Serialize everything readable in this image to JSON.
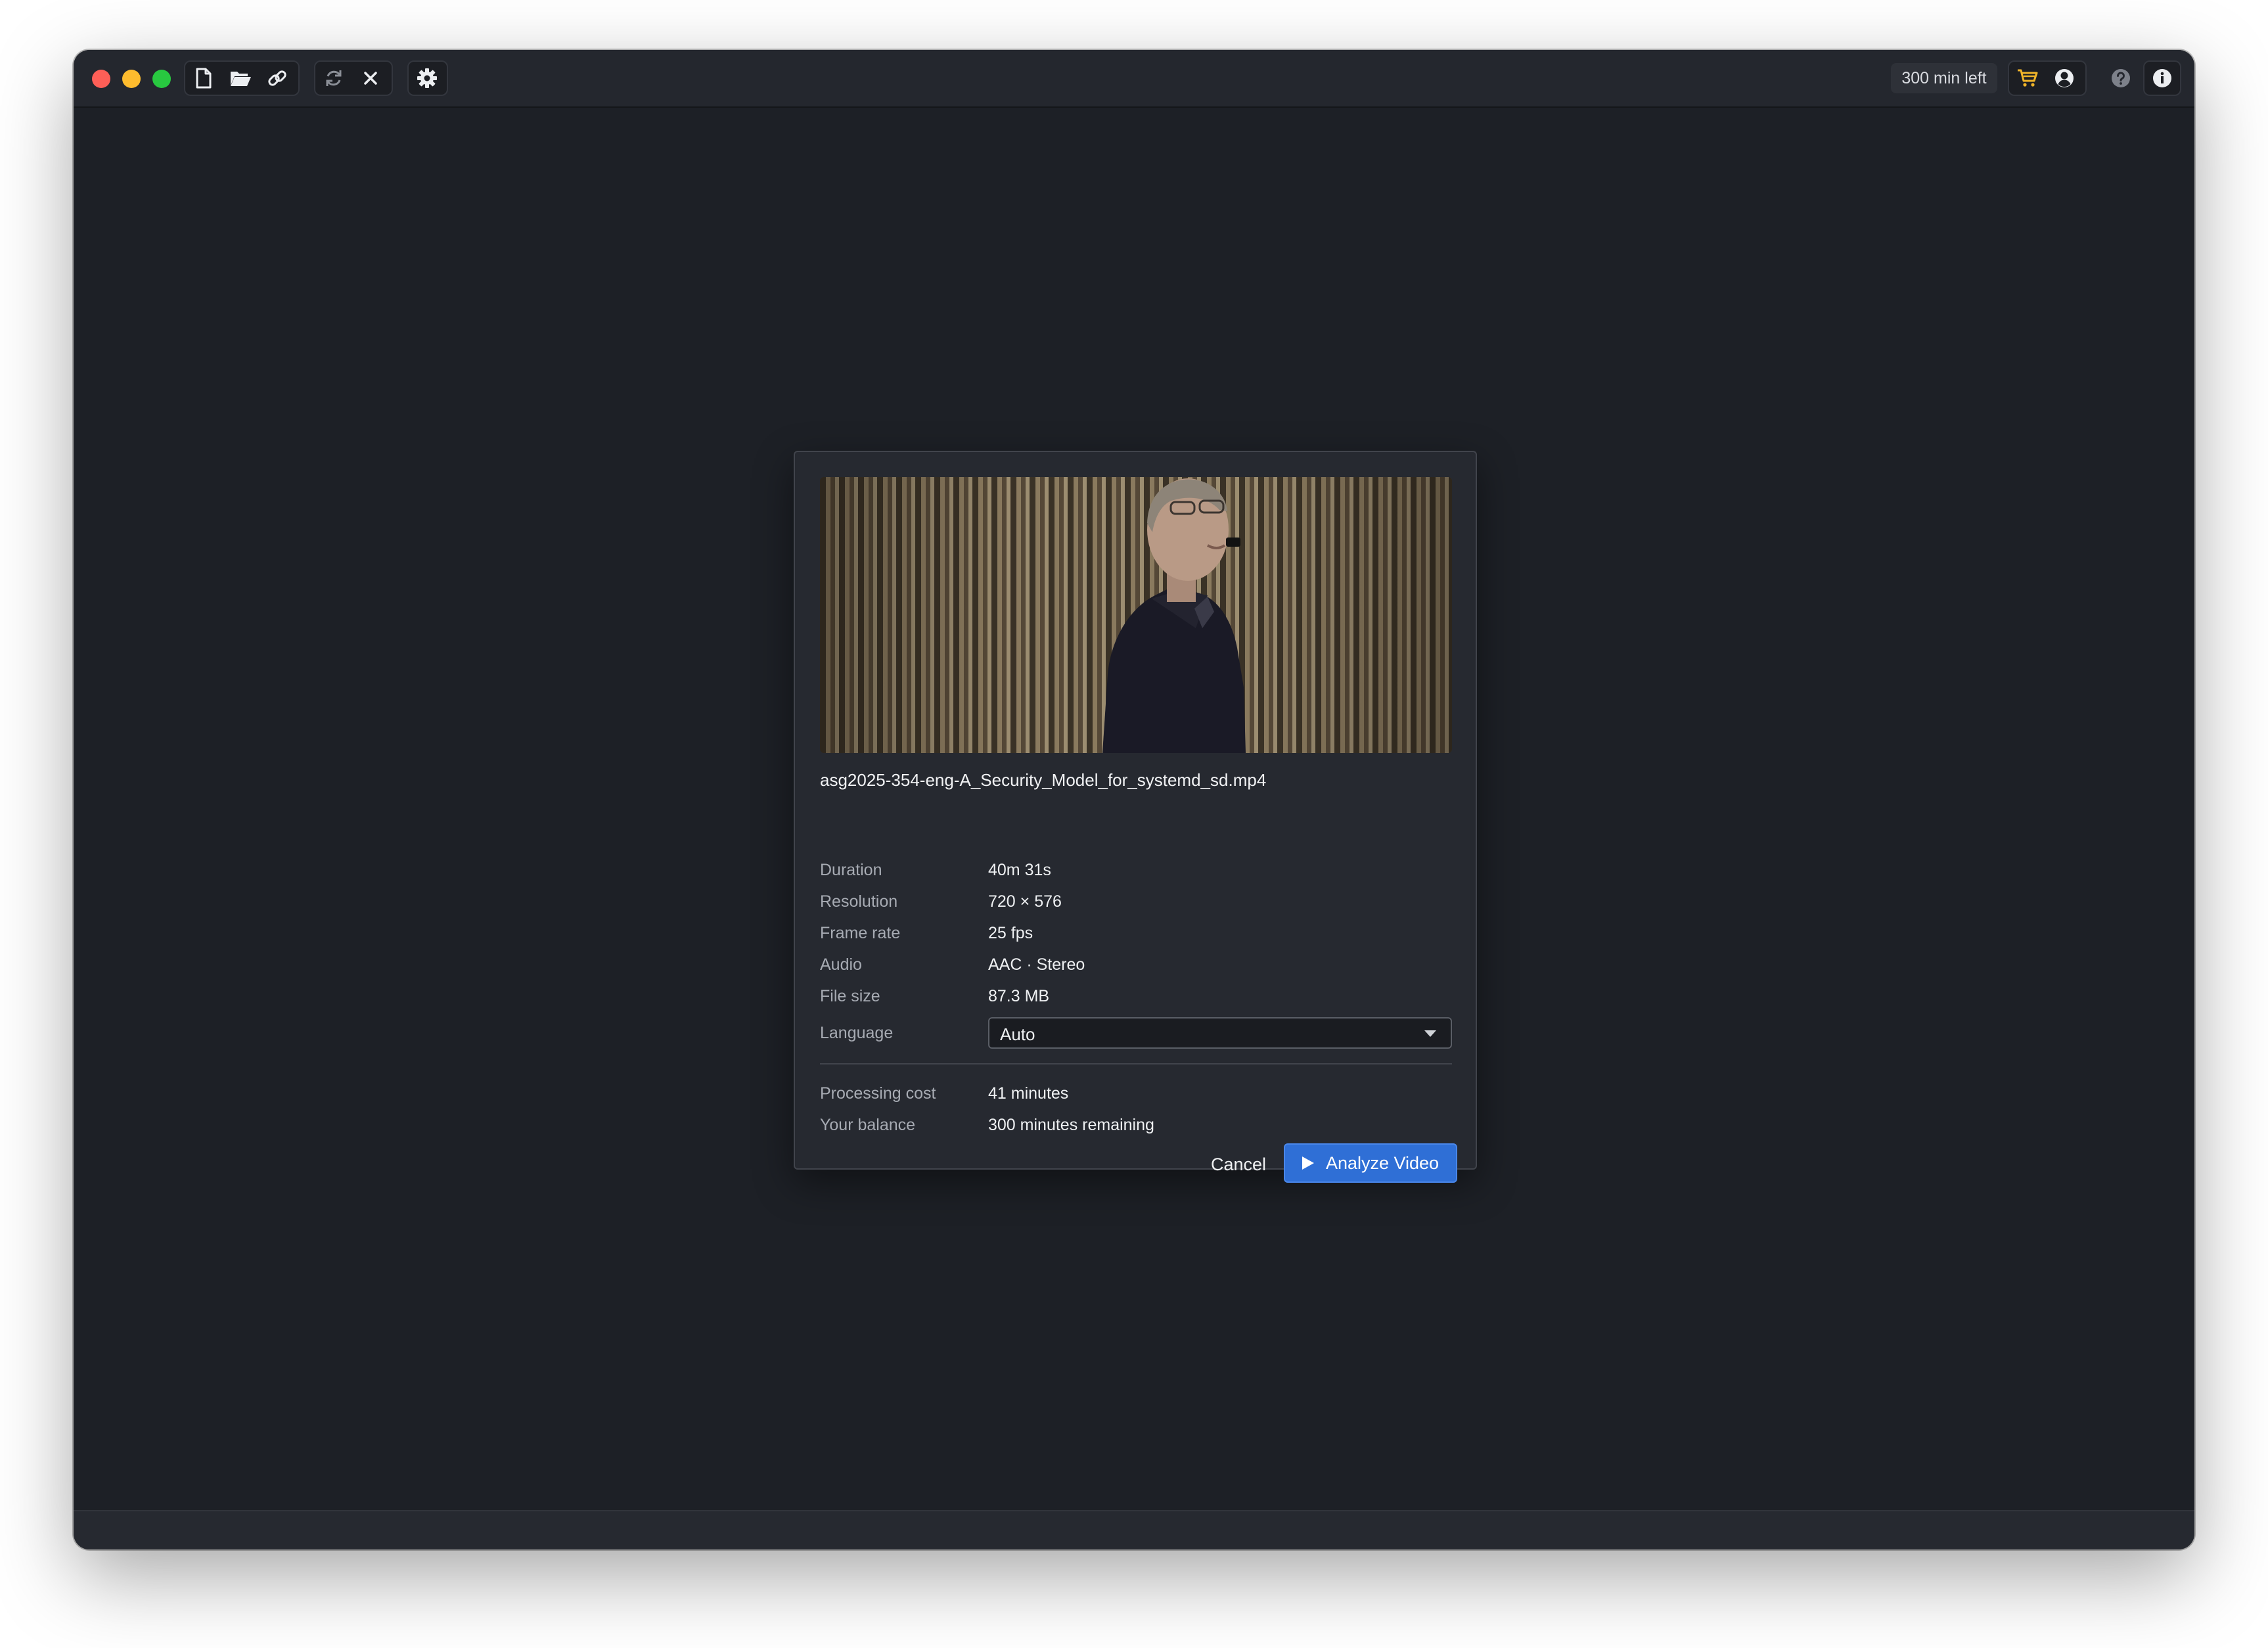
{
  "toolbar": {
    "credits_label": "300 min left"
  },
  "dialog": {
    "filename": "asg2025-354-eng-A_Security_Model_for_systemd_sd.mp4",
    "info": [
      {
        "label": "Duration",
        "value": "40m 31s"
      },
      {
        "label": "Resolution",
        "value": "720 × 576"
      },
      {
        "label": "Frame rate",
        "value": "25 fps"
      },
      {
        "label": "Audio",
        "value": "AAC · Stereo"
      },
      {
        "label": "File size",
        "value": "87.3 MB"
      }
    ],
    "language": {
      "label": "Language",
      "value": "Auto"
    },
    "cost": [
      {
        "label": "Processing cost",
        "value": "41 minutes"
      },
      {
        "label": "Your balance",
        "value": "300 minutes remaining"
      }
    ],
    "cancel_label": "Cancel",
    "analyze_label": "Analyze Video"
  },
  "colors": {
    "accent": "#2f6fd6",
    "cart": "#f0b429",
    "window_bg": "#1d2026"
  },
  "icons": [
    "new-file-icon",
    "open-folder-icon",
    "link-icon",
    "refresh-icon",
    "close-icon",
    "settings-gear-icon",
    "cart-icon",
    "account-icon",
    "help-icon",
    "info-icon",
    "play-icon",
    "chevron-down-icon"
  ]
}
